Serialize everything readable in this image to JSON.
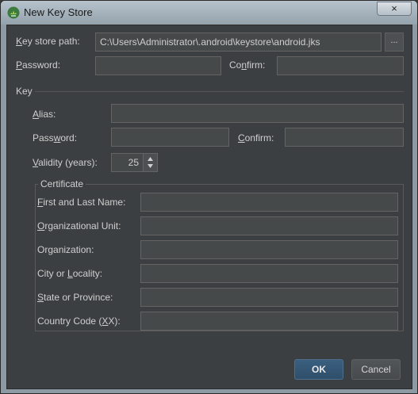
{
  "window": {
    "title": "New Key Store",
    "close_label": "×",
    "icon": "android-studio-icon"
  },
  "keystore": {
    "path_label": "Key store path:",
    "path_value": "C:\\Users\\Administrator\\.android\\keystore\\android.jks",
    "browse_label": "...",
    "password_label": "Password:",
    "password_value": "",
    "confirm_label": "Confirm:",
    "confirm_value": ""
  },
  "key": {
    "section_label": "Key",
    "alias_label": "Alias:",
    "alias_value": "",
    "password_label": "Password:",
    "password_value": "",
    "confirm_label": "Confirm:",
    "confirm_value": "",
    "validity_label": "Validity (years):",
    "validity_value": "25"
  },
  "certificate": {
    "section_label": "Certificate",
    "fields": [
      {
        "label": "First and Last Name:",
        "value": ""
      },
      {
        "label": "Organizational Unit:",
        "value": ""
      },
      {
        "label": "Organization:",
        "value": ""
      },
      {
        "label": "City or Locality:",
        "value": ""
      },
      {
        "label": "State or Province:",
        "value": ""
      },
      {
        "label": "Country Code (XX):",
        "value": ""
      }
    ]
  },
  "buttons": {
    "ok": "OK",
    "cancel": "Cancel"
  }
}
